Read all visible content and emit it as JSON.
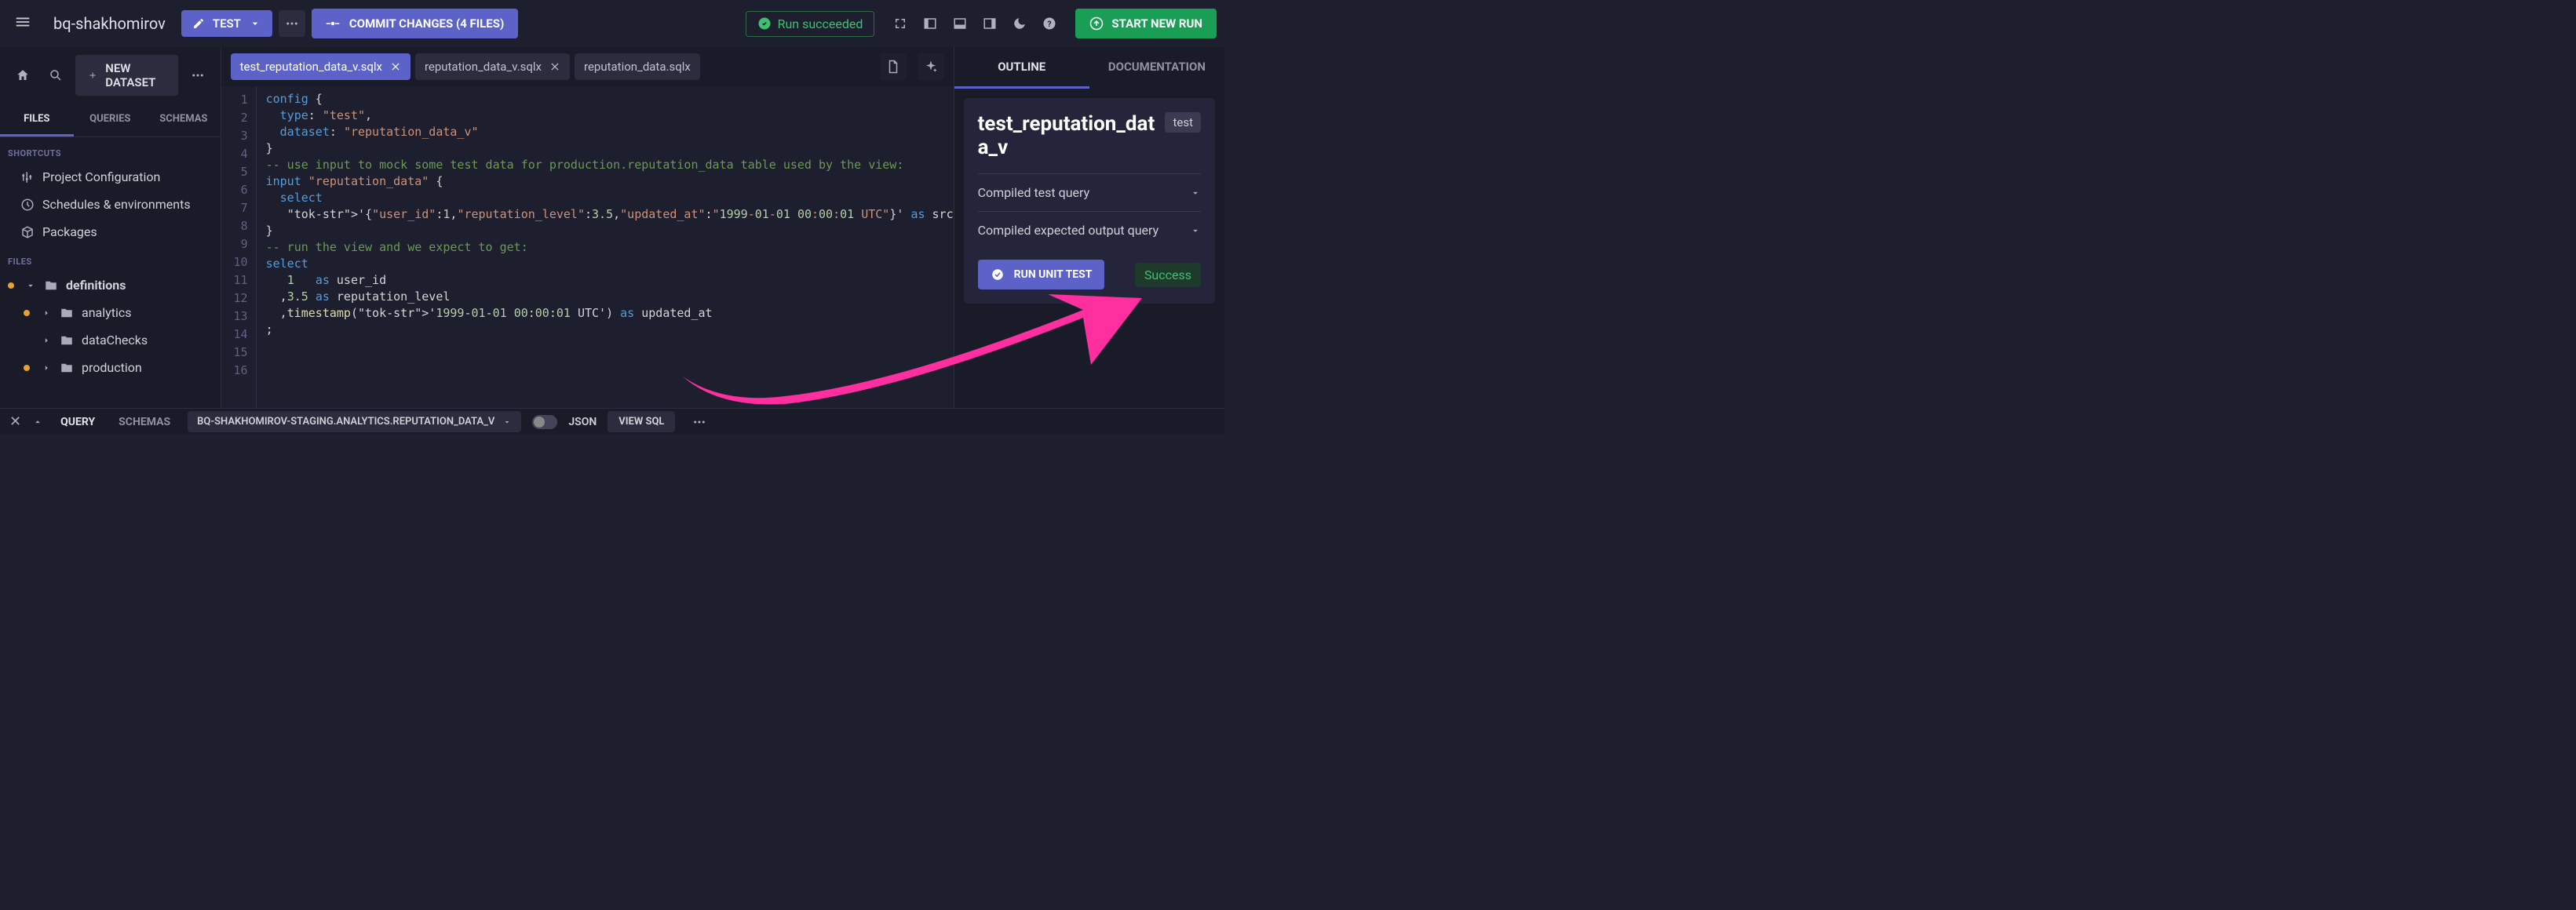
{
  "project_name": "bq-shakhomirov",
  "top": {
    "test_label": "TEST",
    "commit_label": "COMMIT CHANGES (4 FILES)",
    "run_status": "Run succeeded",
    "start_run_label": "START NEW RUN"
  },
  "sidebar": {
    "new_dataset_label": "NEW DATASET",
    "tabs": [
      "FILES",
      "QUERIES",
      "SCHEMAS"
    ],
    "active_tab": "FILES",
    "shortcuts_heading": "SHORTCUTS",
    "shortcuts": [
      {
        "label": "Project Configuration",
        "icon": "sliders-icon"
      },
      {
        "label": "Schedules & environments",
        "icon": "clock-icon"
      },
      {
        "label": "Packages",
        "icon": "package-icon"
      }
    ],
    "files_heading": "FILES",
    "tree": [
      {
        "label": "definitions",
        "modified": true,
        "expanded": true,
        "level": 0
      },
      {
        "label": "analytics",
        "modified": true,
        "expanded": false,
        "level": 1
      },
      {
        "label": "dataChecks",
        "modified": false,
        "expanded": false,
        "level": 1
      },
      {
        "label": "production",
        "modified": true,
        "expanded": false,
        "level": 1
      }
    ]
  },
  "editor": {
    "tabs": [
      {
        "label": "test_reputation_data_v.sqlx",
        "active": true
      },
      {
        "label": "reputation_data_v.sqlx",
        "active": false
      },
      {
        "label": "reputation_data.sqlx",
        "active": false
      }
    ],
    "code_lines": [
      "config {",
      "  type: \"test\",",
      "  dataset: \"reputation_data_v\"",
      "}",
      "-- use input to mock some test data for production.reputation_data table used by the view:",
      "input \"reputation_data\" {",
      "  select",
      "   '{\"user_id\":1,\"reputation_level\":3.5,\"updated_at\":\"1999-01-01 00:00:01 UTC\"}' as src",
      "}",
      "-- run the view and we expect to get:",
      "select",
      "   1   as user_id",
      "  ,3.5 as reputation_level",
      "  ,timestamp('1999-01-01 00:00:01 UTC') as updated_at",
      ";",
      ""
    ]
  },
  "rpanel": {
    "tabs": [
      "OUTLINE",
      "DOCUMENTATION"
    ],
    "active_tab": "OUTLINE",
    "title": "test_reputation_data_v",
    "badge": "test",
    "accordions": [
      "Compiled test query",
      "Compiled expected output query"
    ],
    "run_unit_label": "RUN UNIT TEST",
    "status": "Success"
  },
  "bottom": {
    "tabs": [
      "QUERY",
      "SCHEMAS"
    ],
    "dataset": "BQ-SHAKHOMIROV-STAGING.ANALYTICS.REPUTATION_DATA_V",
    "json_label": "JSON",
    "view_sql": "VIEW SQL"
  }
}
